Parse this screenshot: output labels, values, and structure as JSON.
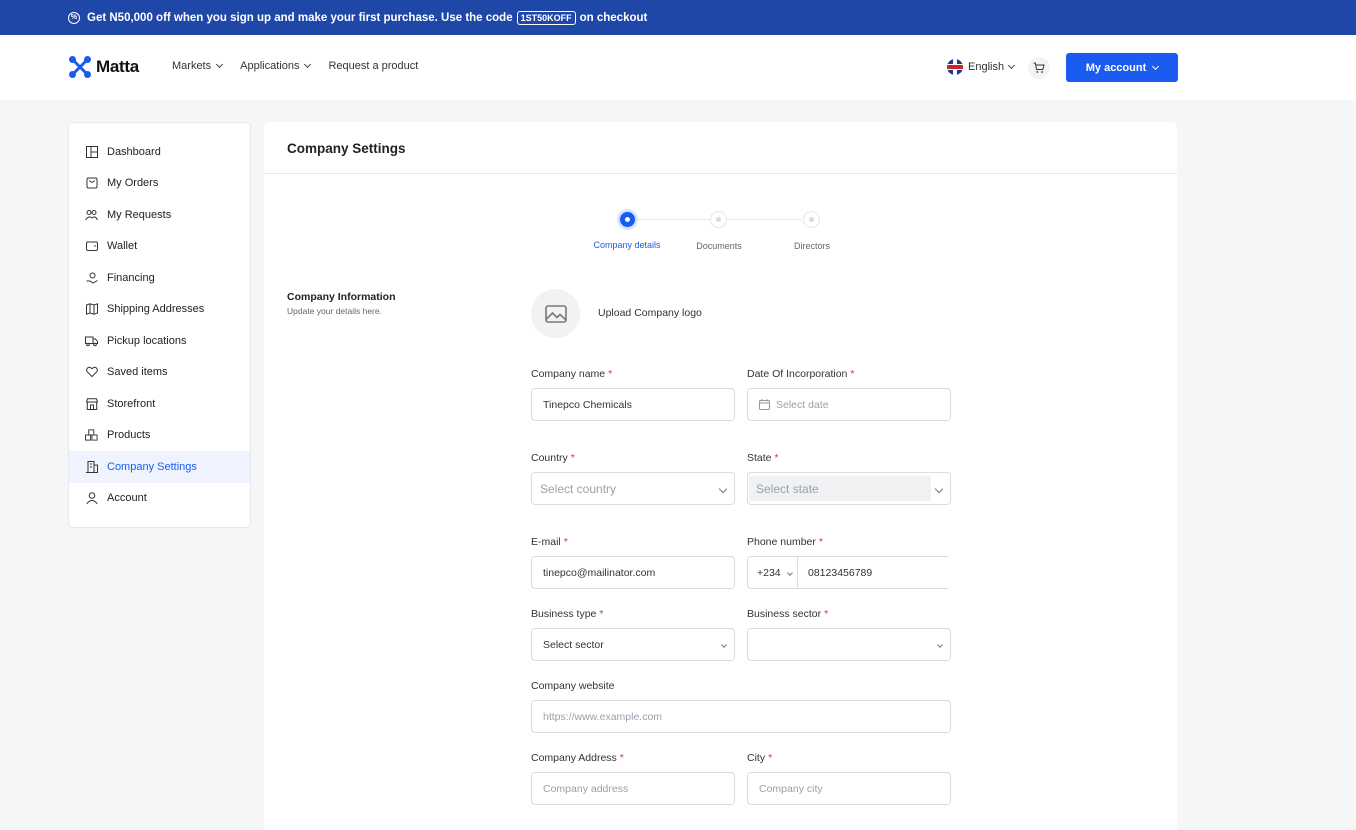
{
  "promo": {
    "text": "Get N50,000 off when you sign up and make your first purchase.  Use the code",
    "code": "1ST50KOFF",
    "suffix": "on checkout"
  },
  "header": {
    "logo": "Matta",
    "nav": [
      "Markets",
      "Applications",
      "Request a product"
    ],
    "language": "English",
    "account_button": "My account"
  },
  "sidebar": {
    "items": [
      {
        "label": "Dashboard",
        "icon": "dashboard-icon"
      },
      {
        "label": "My Orders",
        "icon": "bag-icon"
      },
      {
        "label": "My Requests",
        "icon": "requests-icon"
      },
      {
        "label": "Wallet",
        "icon": "wallet-icon"
      },
      {
        "label": "Financing",
        "icon": "financing-icon"
      },
      {
        "label": "Shipping Addresses",
        "icon": "map-icon"
      },
      {
        "label": "Pickup locations",
        "icon": "truck-icon"
      },
      {
        "label": "Saved items",
        "icon": "heart-icon"
      },
      {
        "label": "Storefront",
        "icon": "store-icon"
      },
      {
        "label": "Products",
        "icon": "products-icon"
      },
      {
        "label": "Company Settings",
        "icon": "building-icon",
        "active": true
      },
      {
        "label": "Account",
        "icon": "user-icon"
      }
    ]
  },
  "main": {
    "title": "Company Settings",
    "steps": [
      "Company details",
      "Documents",
      "Directors"
    ],
    "section_title": "Company Information",
    "section_sub": "Update your details here.",
    "upload_logo": "Upload Company logo"
  },
  "form": {
    "company_name": {
      "label": "Company name",
      "value": "Tinepco Chemicals"
    },
    "date_inc": {
      "label": "Date Of Incorporation",
      "placeholder": "Select date"
    },
    "country": {
      "label": "Country",
      "placeholder": "Select country"
    },
    "state": {
      "label": "State",
      "placeholder": "Select state"
    },
    "email": {
      "label": "E-mail",
      "value": "tinepco@mailinator.com"
    },
    "phone": {
      "label": "Phone number",
      "code": "+234",
      "value": "08123456789"
    },
    "business_type": {
      "label": "Business type",
      "value": "Select sector"
    },
    "business_sector": {
      "label": "Business sector",
      "value": ""
    },
    "website": {
      "label": "Company website",
      "placeholder": "https://www.example.com"
    },
    "address": {
      "label": "Company Address",
      "placeholder": "Company address"
    },
    "city": {
      "label": "City",
      "placeholder": "Company city"
    },
    "req": "*"
  },
  "colors": {
    "primary": "#1a5cf0",
    "promo_bg": "#1f47a8",
    "required": "#e03030"
  }
}
